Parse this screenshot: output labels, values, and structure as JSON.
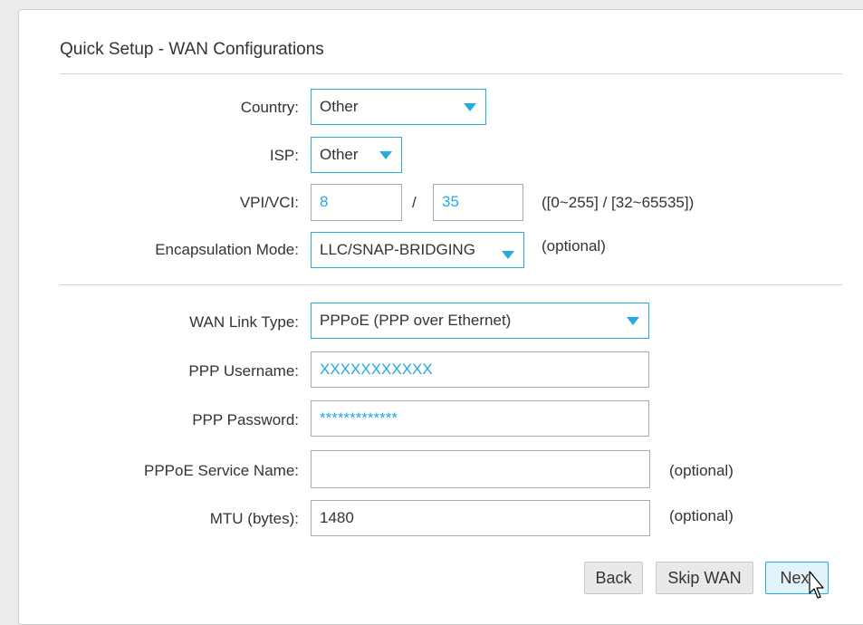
{
  "page": {
    "title": "Quick Setup - WAN Configurations"
  },
  "fields": {
    "country": {
      "label": "Country:",
      "value": "Other"
    },
    "isp": {
      "label": "ISP:",
      "value": "Other"
    },
    "vpi_vci": {
      "label": "VPI/VCI:",
      "vpi": "8",
      "separator": "/",
      "vci": "35",
      "hint": "([0~255] / [32~65535])"
    },
    "encapsulation": {
      "label": "Encapsulation Mode:",
      "value": "LLC/SNAP-BRIDGING",
      "note": "(optional)"
    },
    "wan_link_type": {
      "label": "WAN Link Type:",
      "value": "PPPoE (PPP over Ethernet)"
    },
    "ppp_username": {
      "label": "PPP Username:",
      "value": "XXXXXXXXXXX"
    },
    "ppp_password": {
      "label": "PPP Password:",
      "value": "*************"
    },
    "pppoe_service_name": {
      "label": "PPPoE Service Name:",
      "value": "",
      "note": "(optional)"
    },
    "mtu": {
      "label": "MTU (bytes):",
      "value": "1480",
      "note": "(optional)"
    }
  },
  "buttons": {
    "back": "Back",
    "skip_wan": "Skip WAN",
    "next": "Next"
  },
  "colors": {
    "accent": "#27a9e1",
    "text": "#333333",
    "border": "#aaaaaa"
  },
  "icons": {
    "dropdown": "caret-down-icon",
    "cursor": "mouse-pointer-icon"
  }
}
